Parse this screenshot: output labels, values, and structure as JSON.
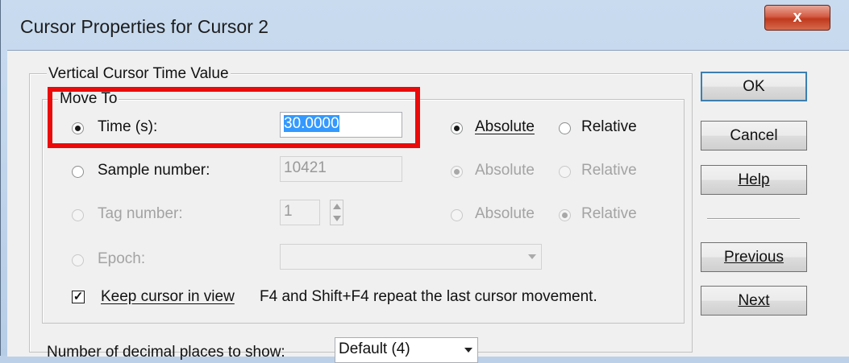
{
  "window": {
    "title": "Cursor Properties for Cursor 2",
    "close_glyph": "x"
  },
  "group_vertical": {
    "legend": "Vertical Cursor Time Value"
  },
  "group_move": {
    "legend": "Move To"
  },
  "rows": {
    "time": {
      "label": "Time (s):",
      "value": "30.0000",
      "absolute_label": "Absolute",
      "relative_label": "Relative"
    },
    "sample": {
      "label": "Sample number:",
      "value": "10421",
      "absolute_label": "Absolute",
      "relative_label": "Relative"
    },
    "tag": {
      "label": "Tag number:",
      "value": "1",
      "absolute_label": "Absolute",
      "relative_label": "Relative"
    },
    "epoch": {
      "label": "Epoch:",
      "value": ""
    }
  },
  "keep_cursor": {
    "label": "Keep cursor in view",
    "checked_glyph": "✓",
    "hint": "F4 and Shift+F4 repeat the last cursor movement."
  },
  "decimal": {
    "label": "Number of decimal places to show:",
    "value": "Default (4)"
  },
  "buttons": {
    "ok": "OK",
    "cancel": "Cancel",
    "help": "Help",
    "previous": "Previous",
    "next": "Next"
  },
  "icons": {
    "close": "close-icon",
    "spin_up": "spin-up-icon",
    "spin_down": "spin-down-icon",
    "dropdown": "chevron-down-icon"
  },
  "colors": {
    "highlight_frame": "#ea0a0a",
    "selection": "#3399ff",
    "close_button": "#c0391d"
  }
}
